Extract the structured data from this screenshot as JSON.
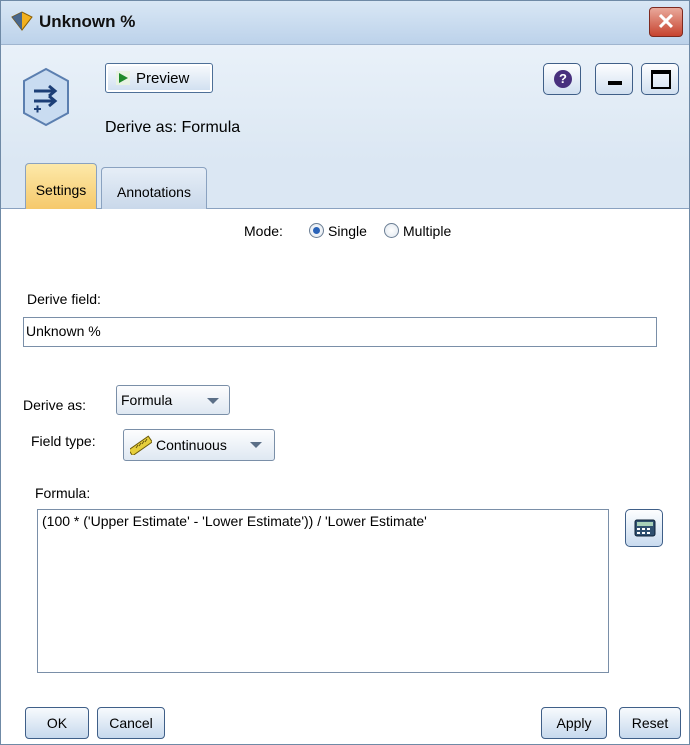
{
  "window": {
    "title": "Unknown %",
    "close_glyph": "✕"
  },
  "toolbar": {
    "preview_label": "Preview",
    "derive_caption": "Derive as: Formula",
    "help_glyph": "?"
  },
  "tabs": [
    {
      "label": "Settings",
      "active": true
    },
    {
      "label": "Annotations",
      "active": false
    }
  ],
  "settings": {
    "mode_label": "Mode:",
    "mode_options": [
      {
        "label": "Single",
        "selected": true
      },
      {
        "label": "Multiple",
        "selected": false
      }
    ],
    "derive_field_label": "Derive field:",
    "derive_field_value": "Unknown %",
    "derive_as_label": "Derive as:",
    "derive_as_value": "Formula",
    "field_type_label": "Field type:",
    "field_type_value": "Continuous",
    "formula_label": "Formula:",
    "formula_value": "(100 * ('Upper Estimate' - 'Lower Estimate')) / 'Lower Estimate'"
  },
  "footer": {
    "ok_label": "OK",
    "cancel_label": "Cancel",
    "apply_label": "Apply",
    "reset_label": "Reset"
  },
  "colors": {
    "active_tab": "#f5c86a",
    "title_bar": "#bcd2ea",
    "close_button": "#c7432f",
    "radio_selected": "#2a63b8"
  }
}
